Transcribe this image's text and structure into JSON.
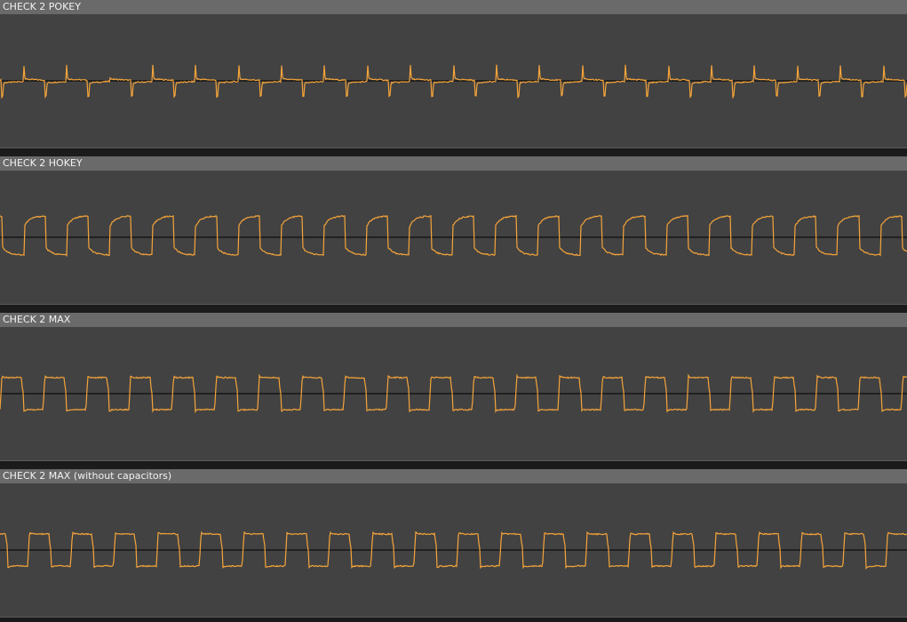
{
  "tracks": [
    {
      "label": "CHECK 2 POKEY",
      "waveform": "spike-square"
    },
    {
      "label": "CHECK 2 HOKEY",
      "waveform": "exponential-square"
    },
    {
      "label": "CHECK 2 MAX",
      "waveform": "rounded-square"
    },
    {
      "label": "CHECK 2 MAX (without capacitors)",
      "waveform": "rounded-square"
    }
  ],
  "colors": {
    "header_bg": "#6a6a6a",
    "header_text": "#f2f2f2",
    "track_bg": "#424242",
    "waveform": "#f5a43a",
    "center_line": "#000000",
    "separator": "#1c1c1c"
  }
}
